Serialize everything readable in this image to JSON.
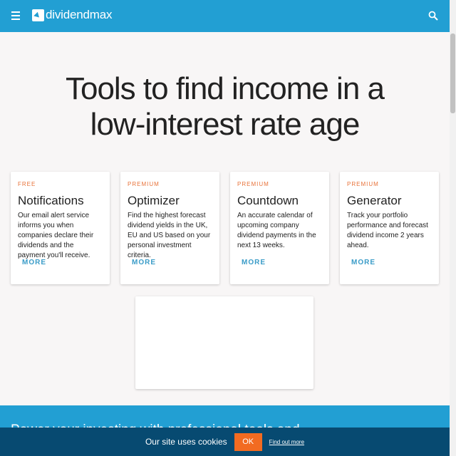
{
  "header": {
    "brand": "dividendmax",
    "menu_icon": "menu-icon",
    "search_icon": "search-icon"
  },
  "hero": {
    "line1": "Tools to find income in a",
    "line2": "low-interest rate age"
  },
  "cards": [
    {
      "tier": "FREE",
      "title": "Notifications",
      "body": "Our email alert service informs you when companies declare their dividends and the payment you'll receive.",
      "more": "MORE"
    },
    {
      "tier": "PREMIUM",
      "title": "Optimizer",
      "body": "Find the highest forecast dividend yields in the UK, EU and US based on your personal investment criteria.",
      "more": "MORE"
    },
    {
      "tier": "PREMIUM",
      "title": "Countdown",
      "body": "An accurate calendar of upcoming company dividend payments in the next 13 weeks.",
      "more": "MORE"
    },
    {
      "tier": "PREMIUM",
      "title": "Generator",
      "body": "Track your portfolio performance and forecast dividend income 2 years ahead.",
      "more": "MORE"
    }
  ],
  "promo": {
    "text": "Power your investing with professional tools and"
  },
  "cookie": {
    "text": "Our site uses cookies",
    "ok": "OK",
    "link": "Find out more"
  },
  "colors": {
    "brand": "#229fd3",
    "accent": "#f26b21",
    "cookie_bg": "#074a71"
  }
}
